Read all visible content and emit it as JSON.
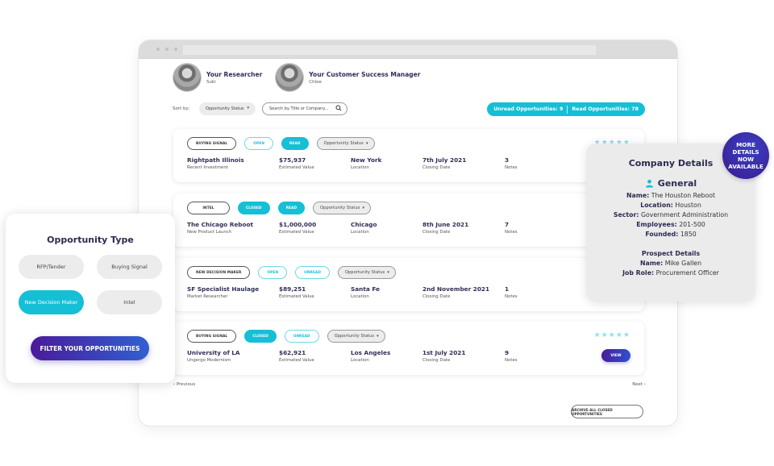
{
  "header": {
    "researcher": {
      "role": "Your Researcher",
      "name": "Suki"
    },
    "csm": {
      "role": "Your Customer Success Manager",
      "name": "Chloe"
    }
  },
  "toolbar": {
    "sort_label": "Sort by:",
    "sort_value": "Opportunity Status",
    "search_placeholder": "Search by Title or Company...",
    "unread_label": "Unread Opportunities: 9",
    "read_label": "Read Opportunities: 78"
  },
  "field_labels": {
    "value": "Estimated Value",
    "location": "Location",
    "closing": "Closing Date",
    "notes": "Notes"
  },
  "status_dropdown_label": "Opportunity Status",
  "opportunities": [
    {
      "type": "Buying Signal",
      "state": "Open",
      "read": "Read",
      "company": "Rightpath Illinois",
      "subtitle": "Recent Investment",
      "value": "$75,937",
      "location": "New York",
      "closing_date": "7th July 2021",
      "notes": "3",
      "stars": "★★★★★"
    },
    {
      "type": "Intel",
      "state": "Closed",
      "read": "Read",
      "company": "The Chicago Reboot",
      "subtitle": "New Product Launch",
      "value": "$1,000,000",
      "location": "Chicago",
      "closing_date": "8th June 2021",
      "notes": "7"
    },
    {
      "type": "New Decision Maker",
      "state": "Open",
      "read": "Unread",
      "company": "SF Specialist Haulage",
      "subtitle": "Market Researcher",
      "value": "$89,251",
      "location": "Santa Fe",
      "closing_date": "2nd November 2021",
      "notes": "1"
    },
    {
      "type": "Buying Signal",
      "state": "Closed",
      "read": "Unread",
      "company": "University of LA",
      "subtitle": "Ungergo Modernism",
      "value": "$62,921",
      "location": "Los Angeles",
      "closing_date": "1st July 2021",
      "notes": "9",
      "stars": "★★★★★",
      "view_label": "View"
    }
  ],
  "pagination": {
    "prev": "‹ Previous",
    "next": "Next ›"
  },
  "archive_label": "Archive all closed opportunities",
  "type_panel": {
    "title": "Opportunity Type",
    "options": [
      "RFP/Tender",
      "Buying Signal",
      "New Decision Maker",
      "Intel"
    ],
    "active": "New Decision Maker",
    "filter_label": "FILTER YOUR OPPORTUNITIES"
  },
  "company_panel": {
    "title": "Company Details",
    "general_title": "General",
    "general": [
      {
        "label": "Name:",
        "value": "The Houston Reboot"
      },
      {
        "label": "Location:",
        "value": "Houston"
      },
      {
        "label": "Sector:",
        "value": "Government Administration"
      },
      {
        "label": "Employees:",
        "value": "201-500"
      },
      {
        "label": "Founded:",
        "value": "1850"
      }
    ],
    "prospect_title": "Prospect Details",
    "prospect": [
      {
        "label": "Name:",
        "value": "Mike Gallen"
      },
      {
        "label": "Job Role:",
        "value": "Procurement Officer"
      }
    ]
  },
  "badge": [
    "MORE",
    "DETAILS",
    "NOW",
    "AVAILABLE"
  ],
  "colors": {
    "accent": "#15bfd6",
    "primary_gradient_start": "#4a1a9a",
    "primary_gradient_end": "#3060d0",
    "text_dark": "#2b2b52"
  }
}
